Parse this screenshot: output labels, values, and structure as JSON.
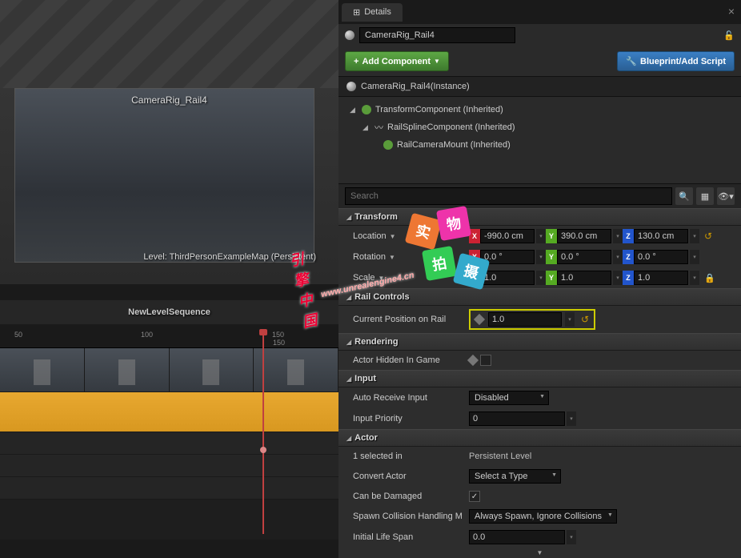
{
  "viewport": {
    "actor_label": "CameraRig_Rail4",
    "level_label": "Level:  ThirdPersonExampleMap (Persistent)"
  },
  "sequencer": {
    "title": "NewLevelSequence",
    "ticks": [
      "50",
      "100",
      "150",
      "150"
    ]
  },
  "details": {
    "tab_title": "Details",
    "name_field": "CameraRig_Rail4",
    "add_component": "Add Component",
    "blueprint_btn": "Blueprint/Add Script",
    "instance": "CameraRig_Rail4(Instance)",
    "components": [
      "TransformComponent (Inherited)",
      "RailSplineComponent (Inherited)",
      "RailCameraMount (Inherited)"
    ],
    "search_placeholder": "Search"
  },
  "transform": {
    "cat": "Transform",
    "loc_label": "Location",
    "loc_x": "-990.0 cm",
    "loc_y": "390.0 cm",
    "loc_z": "130.0 cm",
    "rot_label": "Rotation",
    "rot_x": "0.0 °",
    "rot_y": "0.0 °",
    "rot_z": "0.0 °",
    "scale_label": "Scale",
    "sx": "1.0",
    "sy": "1.0",
    "sz": "1.0"
  },
  "rail": {
    "cat": "Rail Controls",
    "pos_label": "Current Position on Rail",
    "pos": "1.0"
  },
  "rendering": {
    "cat": "Rendering",
    "hidden_label": "Actor Hidden In Game"
  },
  "input": {
    "cat": "Input",
    "auto_label": "Auto Receive Input",
    "auto_val": "Disabled",
    "prio_label": "Input Priority",
    "prio_val": "0"
  },
  "actor": {
    "cat": "Actor",
    "selected": "1 selected in",
    "level": "Persistent Level",
    "convert_label": "Convert Actor",
    "convert_val": "Select a Type",
    "damaged_label": "Can be Damaged",
    "spawn_label": "Spawn Collision Handling M",
    "spawn_val": "Always Spawn, Ignore Collisions",
    "life_label": "Initial Life Span",
    "life_val": "0.0"
  },
  "watermark_text": "引擎中国"
}
